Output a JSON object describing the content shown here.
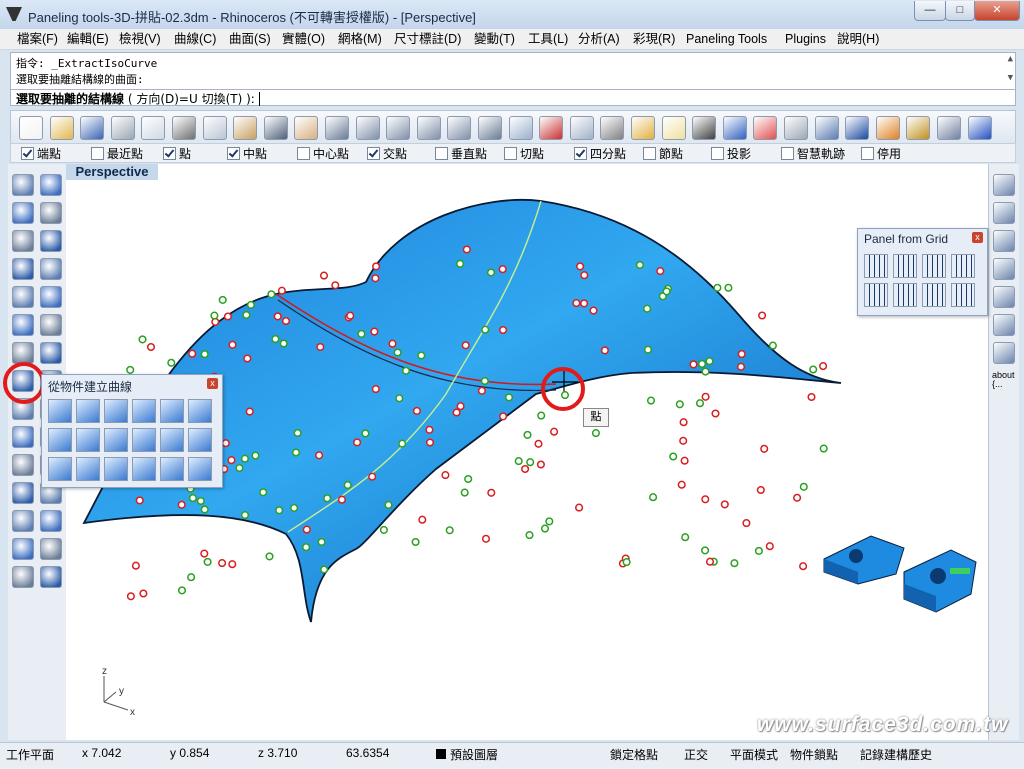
{
  "window": {
    "title": "Paneling tools-3D-拼貼-02.3dm - Rhinoceros (不可轉害授權版) - [Perspective]",
    "buttons": [
      "—",
      "□",
      "✕"
    ]
  },
  "menu": [
    "檔案(F)",
    "編輯(E)",
    "檢視(V)",
    "曲線(C)",
    "曲面(S)",
    "實體(O)",
    "網格(M)",
    "尺寸標註(D)",
    "變動(T)",
    "工具(L)",
    "分析(A)",
    "彩現(R)",
    "Paneling Tools",
    "Plugins",
    "說明(H)"
  ],
  "command": {
    "line1": "指令: _ExtractIsoCurve",
    "line2": "選取要抽離結構線的曲面:",
    "prompt_bold": "選取要抽離的結構線",
    "prompt_rest": " ( 方向(D)=U  切換(T) ): "
  },
  "toolbar": {
    "icons": [
      "new-file-icon",
      "open-folder-icon",
      "save-icon",
      "print-icon",
      "import-icon",
      "cut-icon",
      "copy-icon",
      "paste-icon",
      "undo-icon",
      "pan-hand-icon",
      "rotate-view-icon",
      "zoom-icon",
      "zoom-window-icon",
      "zoom-extents-icon",
      "zoom-selected-icon",
      "redo-view-icon",
      "four-viewports-icon",
      "car-icon",
      "plane-icon",
      "target-icon",
      "point-light-icon",
      "bulb-icon",
      "lock-icon",
      "layer-icon",
      "color-wheel-icon",
      "sphere-wire-icon",
      "grid-sphere-icon",
      "render-sphere-icon",
      "spotlight-icon",
      "gear-icon",
      "options-icon",
      "help-icon"
    ],
    "colors": [
      "#f3f3f3",
      "#e0b850",
      "#3c64b4",
      "#9aa6b4",
      "#d0d8e4",
      "#707070",
      "#b8c4d4",
      "#c8a060",
      "#50607a",
      "#d8b080",
      "#6a7c96",
      "#8090a8",
      "#8090a8",
      "#8090a8",
      "#8090a8",
      "#6a7c96",
      "#9ab0cc",
      "#c83030",
      "#a0b0c8",
      "#808080",
      "#e0b040",
      "#f0e0a0",
      "#404040",
      "#3060c0",
      "#e05050",
      "#9aa6b4",
      "#5a7cb0",
      "#1a4aa0",
      "#e08020",
      "#c09020",
      "#7080a0",
      "#2050c0"
    ]
  },
  "osnap": [
    {
      "label": "端點",
      "on": true
    },
    {
      "label": "最近點",
      "on": false
    },
    {
      "label": "點",
      "on": true
    },
    {
      "label": "中點",
      "on": true
    },
    {
      "label": "中心點",
      "on": false
    },
    {
      "label": "交點",
      "on": true
    },
    {
      "label": "垂直點",
      "on": false
    },
    {
      "label": "切點",
      "on": false
    },
    {
      "label": "四分點",
      "on": true
    },
    {
      "label": "節點",
      "on": false
    },
    {
      "label": "投影",
      "on": false
    },
    {
      "label": "智慧軌跡",
      "on": false
    },
    {
      "label": "停用",
      "on": false
    }
  ],
  "viewport": {
    "tab": "Perspective",
    "tooltip": "點",
    "axis_x": "x",
    "axis_y": "y",
    "axis_z": "z"
  },
  "flyout": {
    "title": "從物件建立曲線",
    "close": "x"
  },
  "panel_grid": {
    "title": "Panel from Grid",
    "close": "x"
  },
  "right_about": "about\n{...",
  "status": {
    "plane": "工作平面",
    "x": "x 7.042",
    "y": "y 0.854",
    "z": "z 3.710",
    "len": "63.6354",
    "layer": "預設圖層",
    "grid_snap": "鎖定格點",
    "ortho": "正交",
    "planar": "平面模式",
    "osnap": "物件鎖點",
    "history": "記錄建構歷史"
  },
  "watermark": "www.surface3d.com.tw"
}
